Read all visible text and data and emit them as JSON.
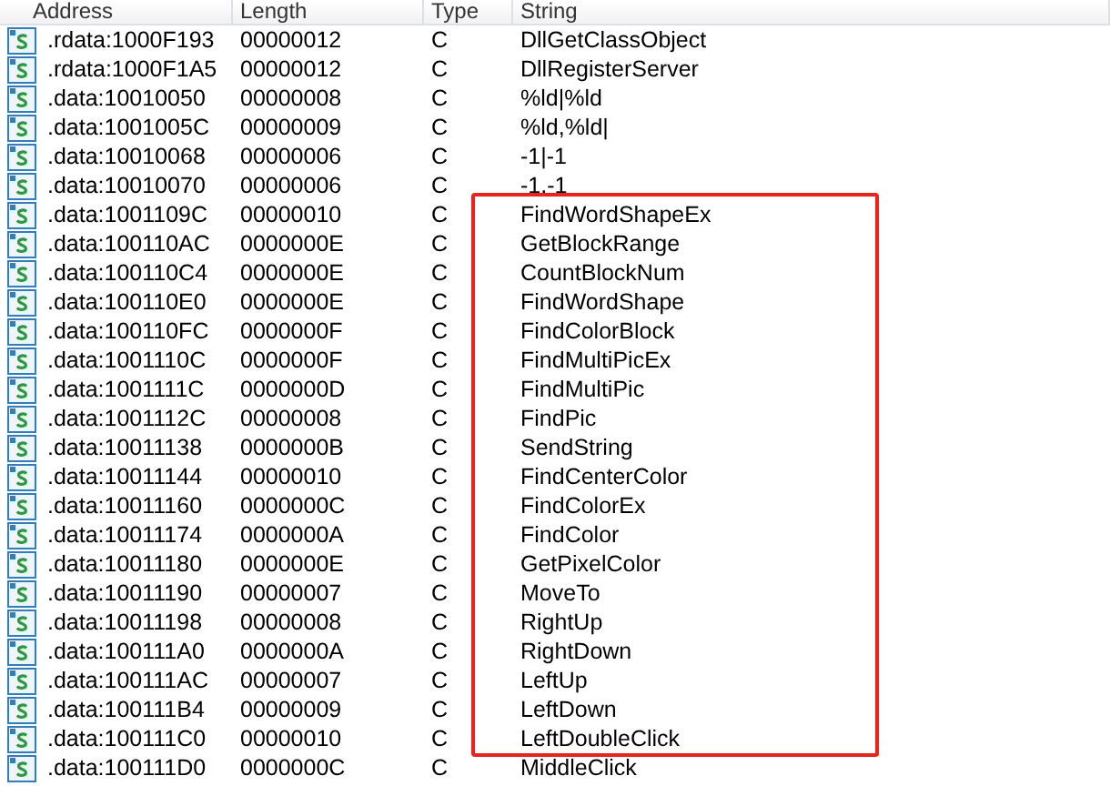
{
  "table": {
    "columns": [
      "Address",
      "Length",
      "Type",
      "String"
    ],
    "row_groups": [
      {
        "framed": false,
        "rows": [
          {
            "address": ".rdata:1000F193",
            "length": "00000012",
            "type": "C",
            "string": "DllGetClassObject"
          },
          {
            "address": ".rdata:1000F1A5",
            "length": "00000012",
            "type": "C",
            "string": "DllRegisterServer"
          },
          {
            "address": ".data:10010050",
            "length": "00000008",
            "type": "C",
            "string": "%ld|%ld"
          },
          {
            "address": ".data:1001005C",
            "length": "00000009",
            "type": "C",
            "string": "%ld,%ld|"
          },
          {
            "address": ".data:10010068",
            "length": "00000006",
            "type": "C",
            "string": "-1|-1"
          },
          {
            "address": ".data:10010070",
            "length": "00000006",
            "type": "C",
            "string": "-1,-1"
          }
        ]
      },
      {
        "framed": true,
        "rows": [
          {
            "address": ".data:1001109C",
            "length": "00000010",
            "type": "C",
            "string": "FindWordShapeEx"
          },
          {
            "address": ".data:100110AC",
            "length": "0000000E",
            "type": "C",
            "string": "GetBlockRange"
          },
          {
            "address": ".data:100110C4",
            "length": "0000000E",
            "type": "C",
            "string": "CountBlockNum"
          },
          {
            "address": ".data:100110E0",
            "length": "0000000E",
            "type": "C",
            "string": "FindWordShape"
          },
          {
            "address": ".data:100110FC",
            "length": "0000000F",
            "type": "C",
            "string": "FindColorBlock"
          },
          {
            "address": ".data:1001110C",
            "length": "0000000F",
            "type": "C",
            "string": "FindMultiPicEx"
          },
          {
            "address": ".data:1001111C",
            "length": "0000000D",
            "type": "C",
            "string": "FindMultiPic"
          },
          {
            "address": ".data:1001112C",
            "length": "00000008",
            "type": "C",
            "string": "FindPic"
          },
          {
            "address": ".data:10011138",
            "length": "0000000B",
            "type": "C",
            "string": "SendString"
          },
          {
            "address": ".data:10011144",
            "length": "00000010",
            "type": "C",
            "string": "FindCenterColor"
          },
          {
            "address": ".data:10011160",
            "length": "0000000C",
            "type": "C",
            "string": "FindColorEx"
          },
          {
            "address": ".data:10011174",
            "length": "0000000A",
            "type": "C",
            "string": "FindColor"
          },
          {
            "address": ".data:10011180",
            "length": "0000000E",
            "type": "C",
            "string": "GetPixelColor"
          },
          {
            "address": ".data:10011190",
            "length": "00000007",
            "type": "C",
            "string": "MoveTo"
          },
          {
            "address": ".data:10011198",
            "length": "00000008",
            "type": "C",
            "string": "RightUp"
          },
          {
            "address": ".data:100111A0",
            "length": "0000000A",
            "type": "C",
            "string": "RightDown"
          },
          {
            "address": ".data:100111AC",
            "length": "00000007",
            "type": "C",
            "string": "LeftUp"
          },
          {
            "address": ".data:100111B4",
            "length": "00000009",
            "type": "C",
            "string": "LeftDown"
          },
          {
            "address": ".data:100111C0",
            "length": "00000010",
            "type": "C",
            "string": "LeftDoubleClick"
          }
        ]
      },
      {
        "framed": false,
        "rows": [
          {
            "address": ".data:100111D0",
            "length": "0000000C",
            "type": "C",
            "string": "MiddleClick"
          }
        ]
      }
    ]
  }
}
